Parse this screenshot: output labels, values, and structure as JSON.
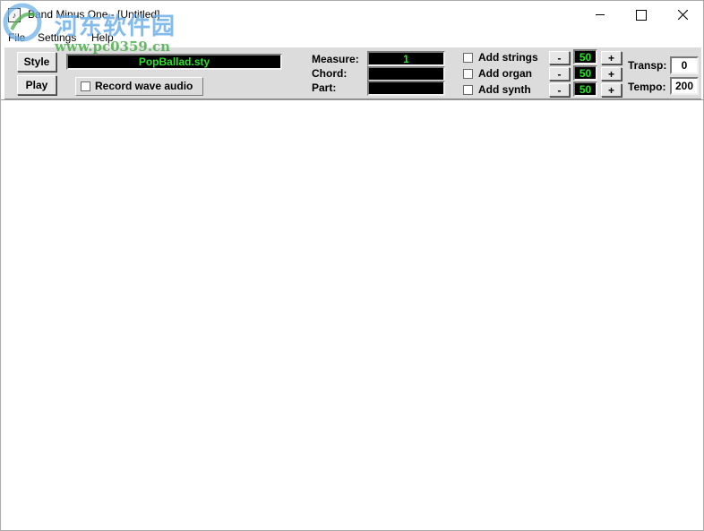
{
  "window": {
    "title": "Band Minus One - [Untitled]",
    "icon_glyph": "♪"
  },
  "menu": {
    "items": [
      "File",
      "Settings",
      "Help"
    ]
  },
  "toolbar": {
    "style_button": "Style",
    "play_button": "Play",
    "style_file": "PopBallad.sty",
    "record_wave_label": "Record wave audio",
    "record_wave_checked": false
  },
  "status": {
    "measure_label": "Measure:",
    "measure_value": "1",
    "chord_label": "Chord:",
    "chord_value": "",
    "part_label": "Part:",
    "part_value": ""
  },
  "instruments": [
    {
      "label": "Add strings",
      "checked": false,
      "value": "50",
      "minus": "-",
      "plus": "+"
    },
    {
      "label": "Add organ",
      "checked": false,
      "value": "50",
      "minus": "-",
      "plus": "+"
    },
    {
      "label": "Add synth",
      "checked": false,
      "value": "50",
      "minus": "-",
      "plus": "+"
    }
  ],
  "transpose": {
    "label": "Transp:",
    "value": "0"
  },
  "tempo": {
    "label": "Tempo:",
    "value": "200"
  },
  "watermark": {
    "cn_text": "河东软件园",
    "url": "www.pc0359.cn"
  },
  "colors": {
    "display_bg": "#000000",
    "display_text": "#2ee02e",
    "panel_bg": "#dcdcdc",
    "watermark_blue": "#6fb0e8",
    "watermark_green": "#4cae4c"
  },
  "icons": {
    "minimize": "minimize-icon",
    "maximize": "maximize-icon",
    "close": "close-icon"
  }
}
